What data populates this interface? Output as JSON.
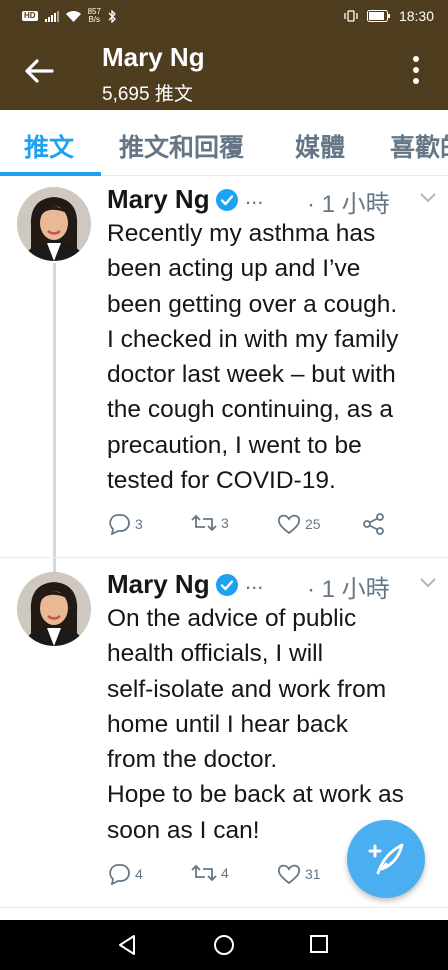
{
  "status_bar": {
    "hd": "HD",
    "net_speed_value": "857",
    "net_speed_unit": "B/s",
    "time": "18:30"
  },
  "header": {
    "name": "Mary Ng",
    "tweet_count": "5,695 推文"
  },
  "tabs": [
    {
      "label": "推文",
      "active": true
    },
    {
      "label": "推文和回覆",
      "active": false
    },
    {
      "label": "媒體",
      "active": false
    },
    {
      "label": "喜歡的",
      "active": false
    }
  ],
  "tweets": [
    {
      "name": "Mary Ng",
      "ellipsis": "...",
      "time": "· 1 小時",
      "text": "Recently my asthma has\nbeen acting up and I’ve\nbeen getting over a cough.\nI checked in with my family\ndoctor last week – but with\nthe cough continuing, as a\nprecaution, I went to be\ntested for COVID-19.",
      "replies": "3",
      "retweets": "3",
      "likes": "25"
    },
    {
      "name": "Mary Ng",
      "ellipsis": "...",
      "time": "· 1 小時",
      "text": "On the advice of public\nhealth officials, I will\nself-isolate and work from\nhome until I hear back\nfrom the doctor.\nHope to be back at work as\nsoon as I can!",
      "replies": "4",
      "retweets": "4",
      "likes": "31"
    }
  ],
  "colors": {
    "header_bg": "#4f3d1f",
    "accent": "#1da1f2",
    "fab": "#4aaef0",
    "muted": "#657786"
  },
  "icons": [
    "back-arrow-icon",
    "more-vertical-icon",
    "verified-badge-icon",
    "chevron-down-icon",
    "reply-icon",
    "retweet-icon",
    "like-icon",
    "share-icon",
    "compose-tweet-icon",
    "nav-back-icon",
    "nav-home-icon",
    "nav-recents-icon"
  ]
}
